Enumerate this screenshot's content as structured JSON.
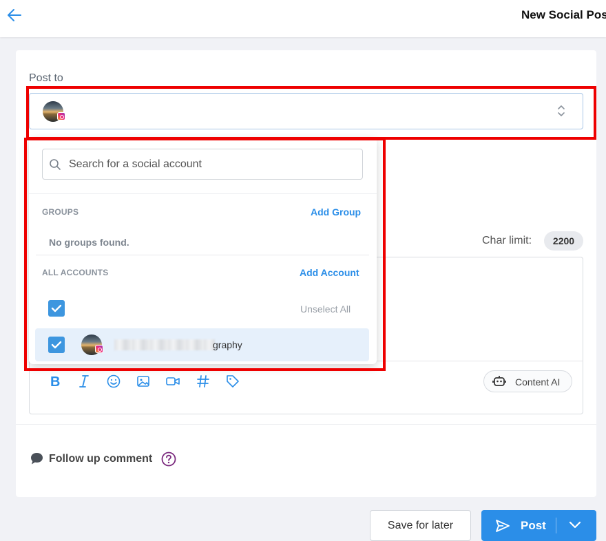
{
  "header": {
    "title": "New Social Post"
  },
  "composer": {
    "post_to_label": "Post to",
    "char_limit_label": "Char limit:",
    "char_limit_value": "2200",
    "content_ai_label": "Content AI",
    "follow_up_label": "Follow up comment"
  },
  "account_dropdown": {
    "search_placeholder": "Search for a social account",
    "groups_label": "GROUPS",
    "add_group_label": "Add Group",
    "no_groups_text": "No groups found.",
    "all_accounts_label": "ALL ACCOUNTS",
    "add_account_label": "Add Account",
    "unselect_all_label": "Unselect All",
    "accounts": [
      {
        "name_visible_suffix": "graphy",
        "platform": "instagram",
        "checked": true
      }
    ]
  },
  "footer": {
    "save_label": "Save for later",
    "post_label": "Post"
  },
  "colors": {
    "accent": "#2b8ee8",
    "checkbox": "#3d96df",
    "highlight": "#ee0000",
    "help_icon": "#7b2a7e"
  },
  "icons": [
    "back-arrow-icon",
    "chevron-updown-icon",
    "search-icon",
    "bold-icon",
    "italic-icon",
    "emoji-icon",
    "image-icon",
    "video-icon",
    "hashtag-icon",
    "tag-icon",
    "robot-icon",
    "comment-icon",
    "help-icon",
    "send-icon",
    "chevron-down-icon",
    "instagram-icon"
  ]
}
